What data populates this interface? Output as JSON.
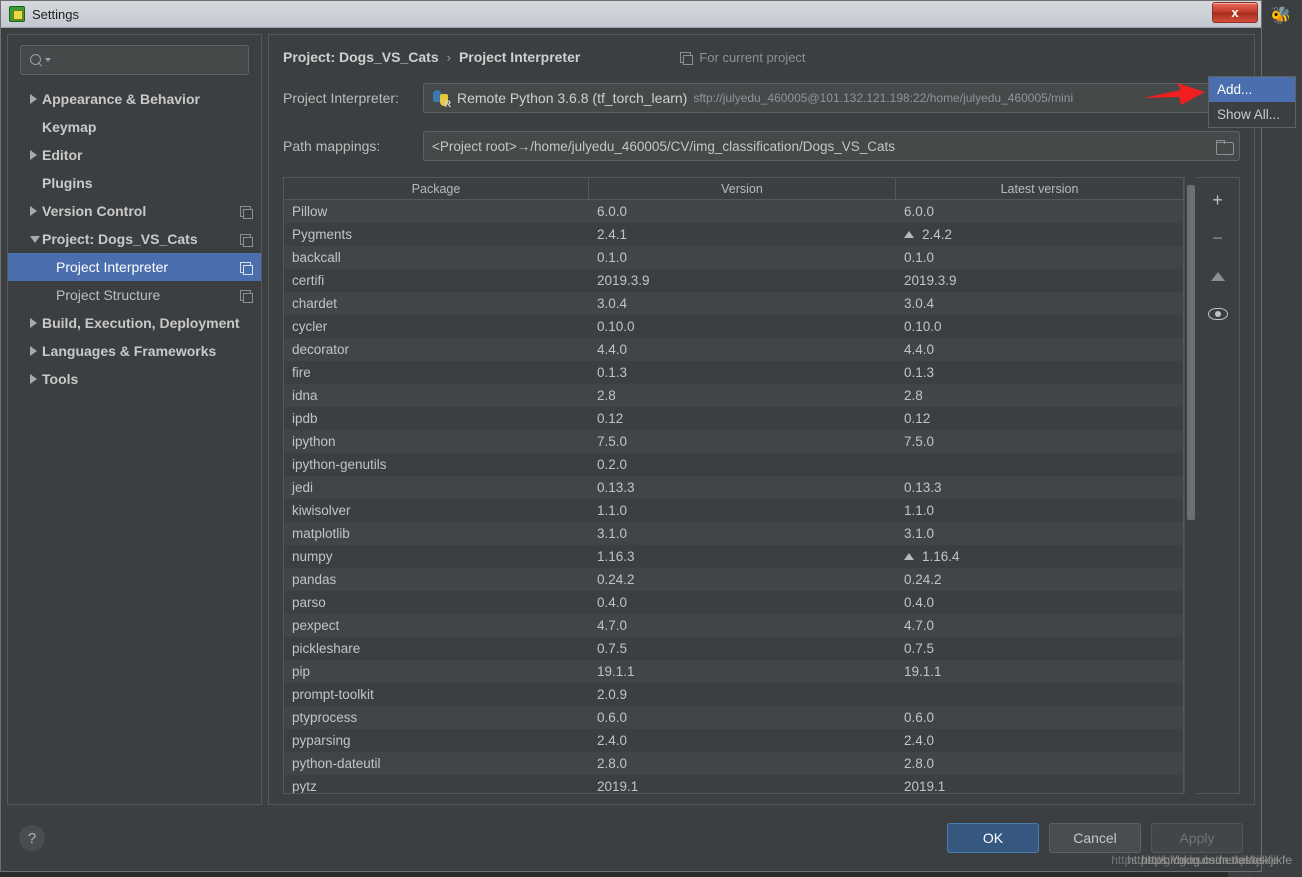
{
  "window": {
    "title": "Settings",
    "app_icon": "settings-app-icon",
    "close_label": "x"
  },
  "sidebar": {
    "search": {
      "value": "",
      "placeholder": "",
      "icon": "search-icon"
    },
    "items": [
      {
        "label": "Appearance & Behavior",
        "arrow": "collapsed",
        "level": 0,
        "bold": true,
        "selected": false,
        "copy": false
      },
      {
        "label": "Keymap",
        "arrow": "none",
        "level": 0,
        "bold": true,
        "selected": false,
        "copy": false
      },
      {
        "label": "Editor",
        "arrow": "collapsed",
        "level": 0,
        "bold": true,
        "selected": false,
        "copy": false
      },
      {
        "label": "Plugins",
        "arrow": "none",
        "level": 0,
        "bold": true,
        "selected": false,
        "copy": false
      },
      {
        "label": "Version Control",
        "arrow": "collapsed",
        "level": 0,
        "bold": true,
        "selected": false,
        "copy": true
      },
      {
        "label": "Project: Dogs_VS_Cats",
        "arrow": "expanded",
        "level": 0,
        "bold": true,
        "selected": false,
        "copy": true
      },
      {
        "label": "Project Interpreter",
        "arrow": "none",
        "level": 1,
        "bold": false,
        "selected": true,
        "copy": true
      },
      {
        "label": "Project Structure",
        "arrow": "none",
        "level": 1,
        "bold": false,
        "selected": false,
        "copy": true
      },
      {
        "label": "Build, Execution, Deployment",
        "arrow": "collapsed",
        "level": 0,
        "bold": true,
        "selected": false,
        "copy": false
      },
      {
        "label": "Languages & Frameworks",
        "arrow": "collapsed",
        "level": 0,
        "bold": true,
        "selected": false,
        "copy": false
      },
      {
        "label": "Tools",
        "arrow": "collapsed",
        "level": 0,
        "bold": true,
        "selected": false,
        "copy": false
      }
    ]
  },
  "main": {
    "breadcrumb_root": "Project: Dogs_VS_Cats",
    "breadcrumb_sep": "›",
    "breadcrumb_leaf": "Project Interpreter",
    "for_current_project": "For current project",
    "interpreter_label": "Project Interpreter:",
    "interpreter_value": "Remote Python 3.6.8 (tf_torch_learn)",
    "interpreter_path": "sftp://julyedu_460005@101.132.121.198:22/home/julyedu_460005/mini",
    "path_mappings_label": "Path mappings:",
    "path_mappings_value": "<Project root>→/home/julyedu_460005/CV/img_classification/Dogs_VS_Cats"
  },
  "popup": {
    "items": [
      {
        "label": "Add...",
        "active": true
      },
      {
        "label": "Show All...",
        "active": false
      }
    ]
  },
  "table": {
    "headers": [
      "Package",
      "Version",
      "Latest version"
    ],
    "rows": [
      {
        "package": "Pillow",
        "version": "6.0.0",
        "latest": "6.0.0",
        "upgrade": false
      },
      {
        "package": "Pygments",
        "version": "2.4.1",
        "latest": "2.4.2",
        "upgrade": true
      },
      {
        "package": "backcall",
        "version": "0.1.0",
        "latest": "0.1.0",
        "upgrade": false
      },
      {
        "package": "certifi",
        "version": "2019.3.9",
        "latest": "2019.3.9",
        "upgrade": false
      },
      {
        "package": "chardet",
        "version": "3.0.4",
        "latest": "3.0.4",
        "upgrade": false
      },
      {
        "package": "cycler",
        "version": "0.10.0",
        "latest": "0.10.0",
        "upgrade": false
      },
      {
        "package": "decorator",
        "version": "4.4.0",
        "latest": "4.4.0",
        "upgrade": false
      },
      {
        "package": "fire",
        "version": "0.1.3",
        "latest": "0.1.3",
        "upgrade": false
      },
      {
        "package": "idna",
        "version": "2.8",
        "latest": "2.8",
        "upgrade": false
      },
      {
        "package": "ipdb",
        "version": "0.12",
        "latest": "0.12",
        "upgrade": false
      },
      {
        "package": "ipython",
        "version": "7.5.0",
        "latest": "7.5.0",
        "upgrade": false
      },
      {
        "package": "ipython-genutils",
        "version": "0.2.0",
        "latest": "",
        "upgrade": false
      },
      {
        "package": "jedi",
        "version": "0.13.3",
        "latest": "0.13.3",
        "upgrade": false
      },
      {
        "package": "kiwisolver",
        "version": "1.1.0",
        "latest": "1.1.0",
        "upgrade": false
      },
      {
        "package": "matplotlib",
        "version": "3.1.0",
        "latest": "3.1.0",
        "upgrade": false
      },
      {
        "package": "numpy",
        "version": "1.16.3",
        "latest": "1.16.4",
        "upgrade": true
      },
      {
        "package": "pandas",
        "version": "0.24.2",
        "latest": "0.24.2",
        "upgrade": false
      },
      {
        "package": "parso",
        "version": "0.4.0",
        "latest": "0.4.0",
        "upgrade": false
      },
      {
        "package": "pexpect",
        "version": "4.7.0",
        "latest": "4.7.0",
        "upgrade": false
      },
      {
        "package": "pickleshare",
        "version": "0.7.5",
        "latest": "0.7.5",
        "upgrade": false
      },
      {
        "package": "pip",
        "version": "19.1.1",
        "latest": "19.1.1",
        "upgrade": false
      },
      {
        "package": "prompt-toolkit",
        "version": "2.0.9",
        "latest": "",
        "upgrade": false
      },
      {
        "package": "ptyprocess",
        "version": "0.6.0",
        "latest": "0.6.0",
        "upgrade": false
      },
      {
        "package": "pyparsing",
        "version": "2.4.0",
        "latest": "2.4.0",
        "upgrade": false
      },
      {
        "package": "python-dateutil",
        "version": "2.8.0",
        "latest": "2.8.0",
        "upgrade": false
      },
      {
        "package": "pytz",
        "version": "2019.1",
        "latest": "2019.1",
        "upgrade": false
      }
    ],
    "toolbar": {
      "add": "+",
      "remove": "−",
      "upgrade": "upgrade-icon",
      "show_early": "eye-icon"
    }
  },
  "footer": {
    "help": "?",
    "ok": "OK",
    "cancel": "Cancel",
    "apply": "Apply"
  },
  "watermark": {
    "line1": "https://blog.csdn.net/askjikfe",
    "line2": "https://blog.csdn.net/askjikfe",
    "line3": "https://blog.csdn.net/askjikfe"
  },
  "colors": {
    "accent": "#4b6eaf",
    "ok_button": "#365880",
    "panel": "#3c3f41",
    "row_alt": "#41454a",
    "annotation_arrow": "#f21f1f"
  }
}
